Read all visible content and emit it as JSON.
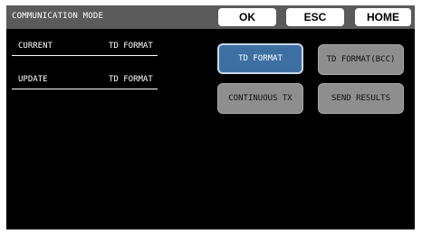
{
  "header": {
    "title": "COMMUNICATION MODE",
    "ok_label": "OK",
    "esc_label": "ESC",
    "home_label": "HOME"
  },
  "status": {
    "current": {
      "label": "CURRENT",
      "value": "TD FORMAT"
    },
    "update": {
      "label": "UPDATE",
      "value": "TD FORMAT"
    }
  },
  "options": {
    "td_format": "TD FORMAT",
    "td_format_bcc": "TD FORMAT(BCC)",
    "continuous_tx": "CONTINUOUS TX",
    "send_results": "SEND RESULTS",
    "selected": "TD FORMAT"
  },
  "colors": {
    "screen_bg": "#000000",
    "header_bg": "#5a5a5a",
    "active_button": "#3e6fa3",
    "inactive_button": "#8e8e8e"
  }
}
